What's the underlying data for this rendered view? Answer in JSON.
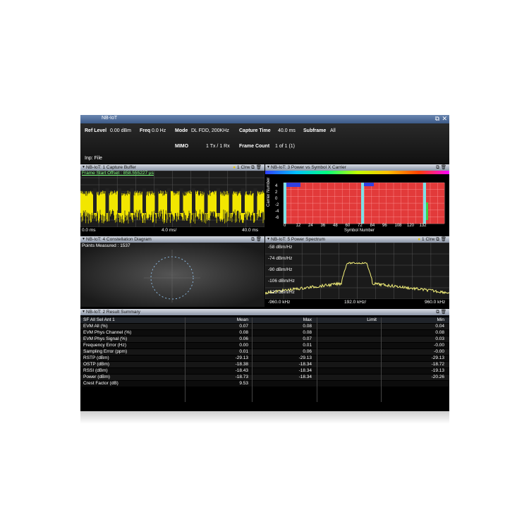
{
  "window": {
    "title": "NB-IoT"
  },
  "header": {
    "ref_level_label": "Ref Level",
    "ref_level": "0.00 dBm",
    "freq_label": "Freq",
    "freq": "0.0 Hz",
    "mode_label": "Mode",
    "mode": "DL FDD, 200KHz",
    "capture_time_label": "Capture Time",
    "capture_time": "40.0 ms",
    "subframe_label": "Subframe",
    "subframe": "All",
    "mimo_label": "MIMO",
    "mimo": "1 Tx / 1 Rx",
    "frame_count_label": "Frame Count",
    "frame_count": "1 of 1 (1)",
    "input": "Inp: File"
  },
  "panel1": {
    "title": "NB-IoT: 1 Capture Buffer",
    "trace": "1 Clrw",
    "frame_offset": "Frame Start Offset : 858.555227 µs",
    "x_start": "0.0 ms",
    "x_div": "4.0 ms/",
    "x_end": "40.0 ms"
  },
  "panel3": {
    "title": "NB-IoT: 3 Power vs Symbol X Carrier",
    "ylabel": "Carrier Number",
    "xlabel": "Symbol Number",
    "x_ticks": [
      "0",
      "12",
      "24",
      "36",
      "48",
      "60",
      "72",
      "84",
      "96",
      "108",
      "120",
      "132"
    ],
    "y_ticks": [
      "4",
      "2",
      "0",
      "-2",
      "-4",
      "-6"
    ]
  },
  "panel4": {
    "title": "NB-IoT: 4 Constellation Diagram",
    "points_measured": "Points Measured : 1537"
  },
  "panel5": {
    "title": "NB-IoT: 5 Power Spectrum",
    "trace": "1 Clrw",
    "y_labels": [
      "-58 dBm/Hz",
      "-74 dBm/Hz",
      "-90 dBm/Hz",
      "-106 dBm/Hz",
      "-122 dBm/Hz"
    ],
    "x_start": "-960.0 kHz",
    "x_div": "192.0 kHz/",
    "x_end": "960.0 kHz"
  },
  "summary": {
    "title": "NB-IoT: 2 Result Summary",
    "columns": {
      "sf": "SF  All  Sel  Ant 1",
      "mean": "Mean",
      "max": "Max",
      "limit": "Limit",
      "min": "Min"
    },
    "rows": [
      {
        "name": "EVM All (%)",
        "mean": "0.07",
        "max": "0.08",
        "min": "0.04"
      },
      {
        "name": "EVM Phys Channel (%)",
        "mean": "0.08",
        "max": "0.08",
        "min": "0.08"
      },
      {
        "name": "EVM Phys Signal (%)",
        "mean": "0.06",
        "max": "0.07",
        "min": "0.03"
      },
      {
        "name": "Frequency Error (Hz)",
        "mean": "0.00",
        "max": "0.01",
        "min": "-0.00"
      },
      {
        "name": "Sampling Error (ppm)",
        "mean": "0.01",
        "max": "0.06",
        "min": "-0.00"
      },
      {
        "name": "RSTP (dBm)",
        "mean": "-29.13",
        "max": "-29.13",
        "min": "-29.13"
      },
      {
        "name": "OSTP (dBm)",
        "mean": "-18.38",
        "max": "-18.34",
        "min": "-18.72"
      },
      {
        "name": "RSSI (dBm)",
        "mean": "-18.43",
        "max": "-18.34",
        "min": "-19.13"
      },
      {
        "name": "Power (dBm)",
        "mean": "-18.73",
        "max": "-18.34",
        "min": "-20.26"
      },
      {
        "name": "Crest Factor (dB)",
        "mean": "9.53",
        "max": "",
        "min": ""
      }
    ]
  }
}
